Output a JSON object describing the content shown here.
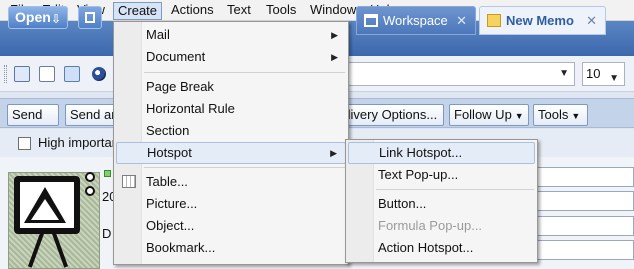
{
  "menubar": {
    "items": [
      "File",
      "Edit",
      "View",
      "Create",
      "Actions",
      "Text",
      "Tools",
      "Window",
      "Help"
    ]
  },
  "tabbar": {
    "open_label": "Open",
    "tabs": [
      {
        "label": "Workspace",
        "icon": "workspace-icon"
      },
      {
        "label": "New Memo",
        "icon": "memo-icon"
      }
    ]
  },
  "toolbar": {
    "font_size": "10"
  },
  "actions": {
    "buttons": [
      "Send",
      "Send and File",
      "Delivery Options...",
      "Follow Up",
      "Tools"
    ]
  },
  "options": {
    "high_importance": "High importance"
  },
  "memo": {
    "date_part": "20",
    "d_part": "D"
  },
  "create_menu": {
    "items": [
      {
        "label": "Mail",
        "submenu": true
      },
      {
        "label": "Document",
        "submenu": true
      },
      {
        "label": "Page Break",
        "submenu": false
      },
      {
        "label": "Horizontal Rule",
        "submenu": false
      },
      {
        "label": "Section",
        "submenu": false
      },
      {
        "label": "Hotspot",
        "submenu": true
      },
      {
        "label": "Table...",
        "submenu": false,
        "icon": "table-icon"
      },
      {
        "label": "Picture...",
        "submenu": false
      },
      {
        "label": "Object...",
        "submenu": false
      },
      {
        "label": "Bookmark...",
        "submenu": false
      }
    ]
  },
  "hotspot_menu": {
    "items": [
      {
        "label": "Link Hotspot...",
        "disabled": false
      },
      {
        "label": "Text Pop-up...",
        "disabled": false
      },
      {
        "label": "Button...",
        "disabled": false
      },
      {
        "label": "Formula Pop-up...",
        "disabled": true
      },
      {
        "label": "Action Hotspot...",
        "disabled": false
      }
    ]
  },
  "colors": {
    "accent_blue": "#3c68ad",
    "menu_highlight": "#e4ecf7",
    "disabled_text": "#9b9b9b"
  }
}
